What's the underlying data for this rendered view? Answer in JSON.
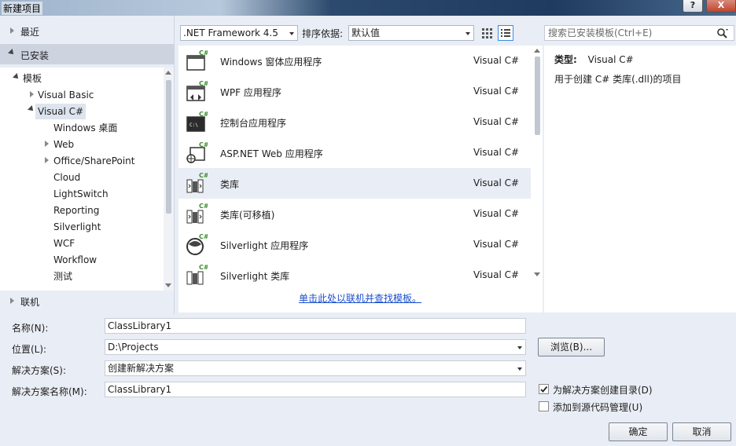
{
  "window": {
    "title": "新建项目",
    "help_label": "?",
    "close_label": "X"
  },
  "left": {
    "recent": "最近",
    "installed": "已安装",
    "online": "联机",
    "tree": {
      "templates": "模板",
      "visual_basic": "Visual Basic",
      "visual_csharp": "Visual C#",
      "children": [
        "Windows 桌面",
        "Web",
        "Office/SharePoint",
        "Cloud",
        "LightSwitch",
        "Reporting",
        "Silverlight",
        "WCF",
        "Workflow",
        "测试"
      ]
    }
  },
  "toolbar": {
    "framework": ".NET Framework 4.5",
    "sort_label": "排序依据:",
    "sort_value": "默认值",
    "search_placeholder": "搜索已安装模板(Ctrl+E)"
  },
  "templates": [
    {
      "name": "Windows 窗体应用程序",
      "lang": "Visual C#",
      "icon": "winforms-icon"
    },
    {
      "name": "WPF 应用程序",
      "lang": "Visual C#",
      "icon": "wpf-icon"
    },
    {
      "name": "控制台应用程序",
      "lang": "Visual C#",
      "icon": "console-icon"
    },
    {
      "name": "ASP.NET Web 应用程序",
      "lang": "Visual C#",
      "icon": "aspnet-icon"
    },
    {
      "name": "类库",
      "lang": "Visual C#",
      "icon": "class-library-icon"
    },
    {
      "name": "类库(可移植)",
      "lang": "Visual C#",
      "icon": "portable-library-icon"
    },
    {
      "name": "Silverlight 应用程序",
      "lang": "Visual C#",
      "icon": "silverlight-icon"
    },
    {
      "name": "Silverlight 类库",
      "lang": "Visual C#",
      "icon": "silverlight-library-icon"
    }
  ],
  "online_link": "单击此处以联机并查找模板。",
  "info": {
    "type_label": "类型:",
    "type_value": "Visual C#",
    "description": "用于创建 C# 类库(.dll)的项目"
  },
  "form": {
    "name_label": "名称(N):",
    "name_value": "ClassLibrary1",
    "location_label": "位置(L):",
    "location_value": "D:\\Projects",
    "solution_label": "解决方案(S):",
    "solution_value": "创建新解决方案",
    "solution_name_label": "解决方案名称(M):",
    "solution_name_value": "ClassLibrary1",
    "browse": "浏览(B)...",
    "create_dir": "为解决方案创建目录(D)",
    "create_dir_checked": true,
    "source_control": "添加到源代码管理(U)",
    "source_control_checked": false,
    "ok": "确定",
    "cancel": "取消"
  }
}
